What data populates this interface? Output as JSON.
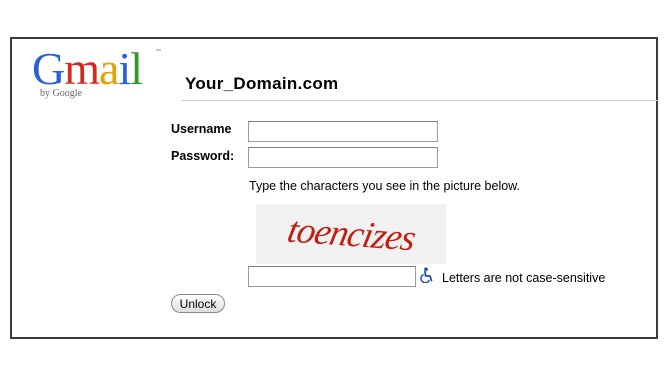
{
  "logo": {
    "brand": "Gmail",
    "tagline": "by Google",
    "trademark": "™"
  },
  "page": {
    "title": "Your_Domain.com"
  },
  "form": {
    "username_label": "Username",
    "username_value": "",
    "password_label": "Password:",
    "password_value": "",
    "captcha_instructions": "Type the characters you see in the picture below.",
    "captcha_text": "toencizes",
    "captcha_answer": "",
    "case_note": "Letters are not case-sensitive",
    "unlock_label": "Unlock"
  },
  "icons": {
    "accessibility": "wheelchair-icon"
  },
  "colors": {
    "gmail_blue": "#2a62d6",
    "gmail_red": "#d22a1e",
    "gmail_yellow": "#e2a306",
    "gmail_green": "#2c9a2c",
    "captcha_red": "#c11f13",
    "accessibility_blue": "#1f4fa8"
  }
}
